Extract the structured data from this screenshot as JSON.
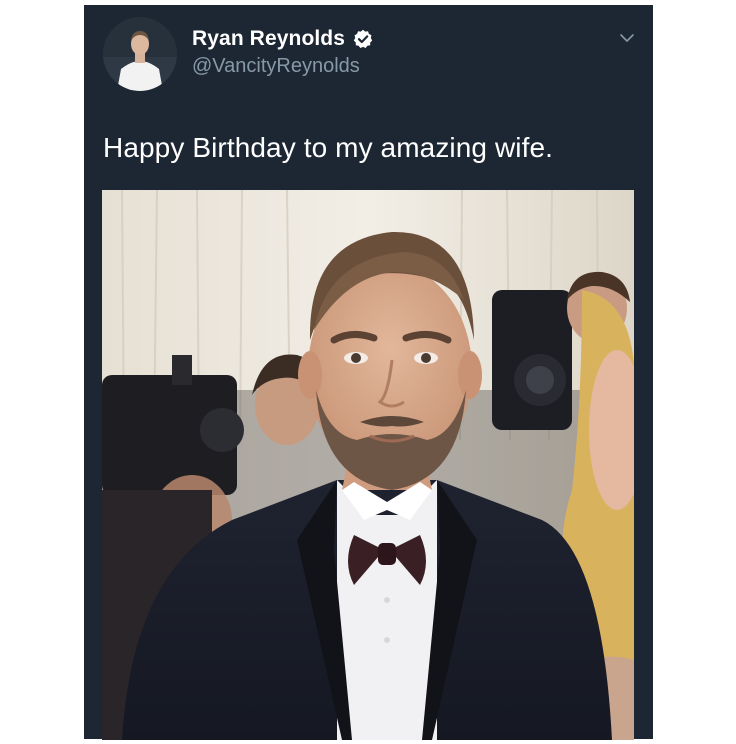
{
  "tweet": {
    "display_name": "Ryan Reynolds",
    "handle": "@VancityReynolds",
    "text": "Happy Birthday to my amazing wife.",
    "verified": true
  },
  "icons": {
    "verified_badge": "verified-badge-icon",
    "more_options": "chevron-down-icon"
  },
  "colors": {
    "card_background": "#1c2733",
    "name_text": "#ffffff",
    "handle_text": "#8899a6",
    "tweet_text": "#ffffff",
    "page_background": "#ffffff"
  }
}
